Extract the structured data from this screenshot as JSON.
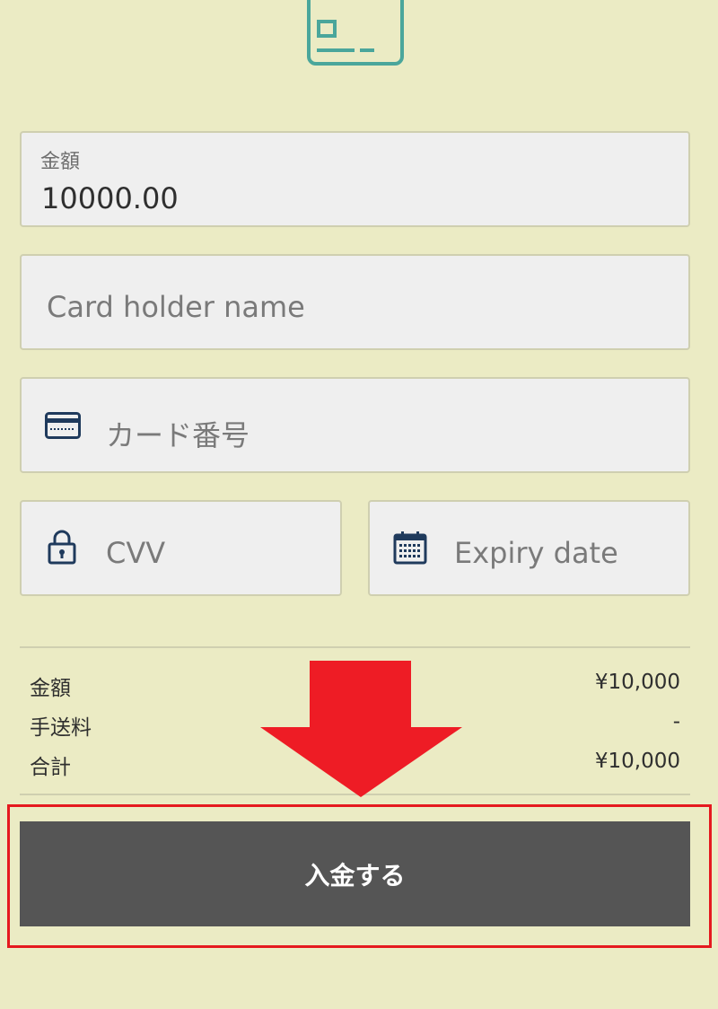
{
  "colors": {
    "background": "#ebebc4",
    "field_bg": "#efefef",
    "button_bg": "#555555",
    "annotation_red": "#e5191f",
    "logo_teal": "#4aa69b",
    "icon_navy": "#1f3a5c"
  },
  "header": {
    "logo_icon": "credit-card-icon"
  },
  "form": {
    "amount": {
      "label": "金額",
      "value": "10000.00"
    },
    "card_holder": {
      "placeholder": "Card holder name"
    },
    "card_number": {
      "placeholder": "カード番号",
      "icon": "credit-card-icon"
    },
    "cvv": {
      "placeholder": "CVV",
      "icon": "lock-icon"
    },
    "expiry": {
      "placeholder": "Expiry date",
      "icon": "calendar-icon"
    }
  },
  "summary": {
    "rows": [
      {
        "label": "金額",
        "value": "¥10,000"
      },
      {
        "label": "手送料",
        "value": "-"
      },
      {
        "label": "合計",
        "value": "¥10,000"
      }
    ]
  },
  "submit": {
    "label": "入金する"
  },
  "annotation": {
    "arrow_icon": "down-arrow-icon"
  }
}
